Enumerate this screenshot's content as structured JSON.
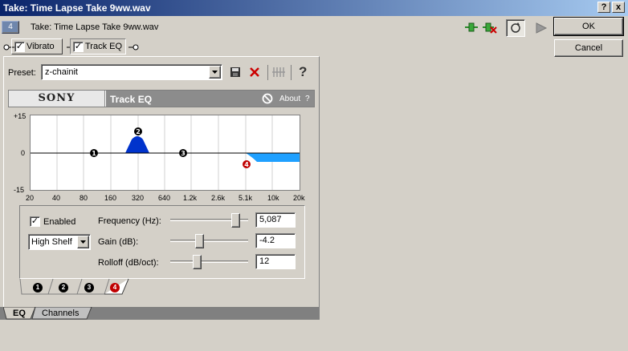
{
  "window": {
    "title": "Take: Time Lapse Take 9ww.wav",
    "help_btn": "?",
    "close_btn": "x"
  },
  "header": {
    "take_number": "4",
    "take_label": "Take: Time Lapse Take 9ww.wav"
  },
  "chain": {
    "items": [
      {
        "label": "Vibrato",
        "checked": true
      },
      {
        "label": "Track EQ",
        "checked": true
      }
    ]
  },
  "buttons": {
    "ok": "OK",
    "cancel": "Cancel"
  },
  "preset": {
    "label": "Preset:",
    "value": "z-chainit"
  },
  "plugin": {
    "brand": "SONY",
    "name": "Track EQ",
    "about": "About",
    "help": "?"
  },
  "graph": {
    "y_labels": [
      "+15",
      "0",
      "-15"
    ],
    "x_labels": [
      "20",
      "40",
      "80",
      "160",
      "320",
      "640",
      "1.2k",
      "2.6k",
      "5.1k",
      "10k",
      "20k"
    ],
    "markers": [
      "1",
      "2",
      "3",
      "4"
    ]
  },
  "bands": {
    "enabled_label": "Enabled",
    "enabled": true,
    "filter_type": "High Shelf",
    "controls": [
      {
        "label": "Frequency (Hz):",
        "value": "5,087",
        "position": 0.88
      },
      {
        "label": "Gain (dB):",
        "value": "-4.2",
        "position": 0.36
      },
      {
        "label": "Rolloff (dB/oct):",
        "value": "12",
        "position": 0.33
      }
    ],
    "tabs": [
      "1",
      "2",
      "3",
      "4"
    ],
    "active_tab": 3
  },
  "bottom_tabs": [
    "EQ",
    "Channels"
  ],
  "colors": {
    "title_start": "#0a246a",
    "title_end": "#a6caf0",
    "band_fill": "#0033cc",
    "shelf_fill": "#1fa0ff",
    "marker_active": "#c00000"
  }
}
